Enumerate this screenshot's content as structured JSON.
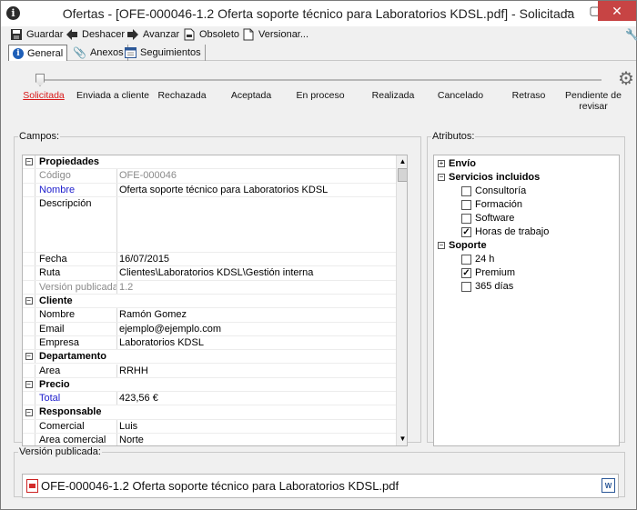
{
  "window": {
    "title": "Ofertas - [OFE-000046-1.2 Oferta soporte técnico para Laboratorios KDSL.pdf] - Solicitada",
    "min": "–",
    "max": "▢",
    "close": "✕"
  },
  "toolbar": {
    "guardar": "Guardar",
    "deshacer": "Deshacer",
    "avanzar": "Avanzar",
    "obsoleto": "Obsoleto",
    "versionar": "Versionar..."
  },
  "tabs": {
    "general": "General",
    "anexos": "Anexos",
    "seguimientos": "Seguimientos"
  },
  "workflow": {
    "steps": [
      "Solicitada",
      "Enviada a cliente",
      "Rechazada",
      "Aceptada",
      "En proceso",
      "Realizada",
      "Cancelado",
      "Retraso",
      "Pendiente de revisar"
    ],
    "current": "Solicitada"
  },
  "campos": {
    "legend": "Campos:",
    "propiedades": {
      "title": "Propiedades",
      "codigo_label": "Código",
      "codigo": "OFE-000046",
      "nombre_label": "Nombre",
      "nombre": "Oferta soporte técnico para Laboratorios KDSL",
      "descripcion_label": "Descripción",
      "descripcion": "",
      "fecha_label": "Fecha",
      "fecha": "16/07/2015",
      "ruta_label": "Ruta",
      "ruta": "Clientes\\Laboratorios KDSL\\Gestión interna",
      "version_label": "Versión publicada",
      "version": "1.2"
    },
    "cliente": {
      "title": "Cliente",
      "nombre_label": "Nombre",
      "nombre": "Ramón Gomez",
      "email_label": "Email",
      "email": "ejemplo@ejemplo.com",
      "empresa_label": "Empresa",
      "empresa": "Laboratorios KDSL"
    },
    "departamento": {
      "title": "Departamento",
      "area_label": "Area",
      "area": "RRHH"
    },
    "precio": {
      "title": "Precio",
      "total_label": "Total",
      "total": "423,56 €"
    },
    "responsable": {
      "title": "Responsable",
      "comercial_label": "Comercial",
      "comercial": "Luis",
      "area_label": "Area comercial",
      "area": "Norte"
    }
  },
  "atributos": {
    "legend": "Atributos:",
    "envio": "Envío",
    "servicios": {
      "title": "Servicios incluidos",
      "items": [
        {
          "label": "Consultoría",
          "checked": false
        },
        {
          "label": "Formación",
          "checked": false
        },
        {
          "label": "Software",
          "checked": false
        },
        {
          "label": "Horas de trabajo",
          "checked": true
        }
      ]
    },
    "soporte": {
      "title": "Soporte",
      "items": [
        {
          "label": "24 h",
          "checked": false
        },
        {
          "label": "Premium",
          "checked": true
        },
        {
          "label": "365 días",
          "checked": false
        }
      ]
    }
  },
  "version_publicada": {
    "legend": "Versión publicada:",
    "file": "OFE-000046-1.2 Oferta soporte técnico para Laboratorios KDSL.pdf"
  }
}
